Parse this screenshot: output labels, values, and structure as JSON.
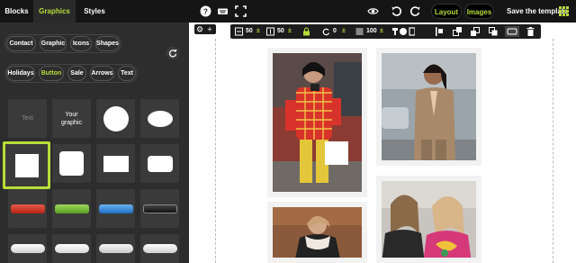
{
  "tabs": [
    {
      "label": "Blocks"
    },
    {
      "label": "Graphics"
    },
    {
      "label": "Styles"
    }
  ],
  "toolbar_top": {
    "layout_label": "Layout",
    "images_label": "Images",
    "save_label": "Save the template"
  },
  "colors": {
    "accent": "#b7dd3a",
    "dark": "#151515",
    "panel": "#2d2d2d"
  },
  "filters_row1": [
    "Contact",
    "Graphic",
    "Icons",
    "Shapes"
  ],
  "filters_row2": [
    "Holidays",
    "Button",
    "Sale",
    "Arrows",
    "Text"
  ],
  "active_filter": "Button",
  "tiles": {
    "text_label": "Text",
    "graphic_label_line1": "Your",
    "graphic_label_line2": "graphic"
  },
  "edit_toolbar": {
    "width_value": "50",
    "height_value": "50",
    "rotation_value": "0",
    "opacity_value": "100"
  },
  "icons": [
    "help-icon",
    "keyboard-icon",
    "fullscreen-icon",
    "eye-icon",
    "undo-icon",
    "redo-icon",
    "grid-icon",
    "refresh-icon",
    "trash-icon",
    "lock-icon"
  ]
}
